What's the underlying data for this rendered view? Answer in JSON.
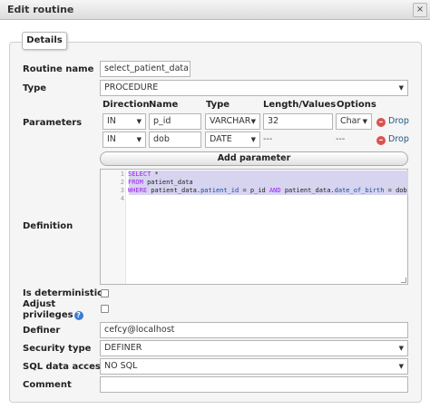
{
  "dialog": {
    "title": "Edit routine",
    "close_symbol": "×"
  },
  "tab": {
    "label": "Details"
  },
  "labels": {
    "routine_name": "Routine name",
    "type": "Type",
    "parameters": "Parameters",
    "definition": "Definition",
    "is_deterministic": "Is deterministic",
    "adjust_line1": "Adjust",
    "adjust_line2": "privileges",
    "definer": "Definer",
    "security_type": "Security type",
    "sql_data_access": "SQL data access",
    "comment": "Comment"
  },
  "values": {
    "routine_name": "select_patient_data",
    "type": "PROCEDURE",
    "definer": "cefcy@localhost",
    "security_type": "DEFINER",
    "sql_data_access": "NO SQL",
    "comment": ""
  },
  "params": {
    "headers": {
      "direction": "Direction",
      "name": "Name",
      "type": "Type",
      "length": "Length/Values",
      "options": "Options"
    },
    "rows": [
      {
        "direction": "IN",
        "name": "p_id",
        "type": "VARCHAR",
        "length": "32",
        "options": "Char",
        "drop": "Drop"
      },
      {
        "direction": "IN",
        "name": "dob",
        "type": "DATE",
        "length": "---",
        "options": "---",
        "drop": "Drop"
      }
    ],
    "add_label": "Add parameter"
  },
  "editor": {
    "line_numbers": [
      "1",
      "2",
      "3",
      "4"
    ],
    "line1": {
      "kw": "SELECT",
      "rest": " *"
    },
    "line2": {
      "kw": "FROM",
      "rest": " patient_data"
    },
    "line3": {
      "kw1": "WHERE",
      "t1": " patient_data.",
      "a1": "patient_id",
      "t2": " = p_id ",
      "kw2": "AND",
      "t3": " patient_data.",
      "a2": "date_of_birth",
      "t4": " = dob"
    }
  }
}
